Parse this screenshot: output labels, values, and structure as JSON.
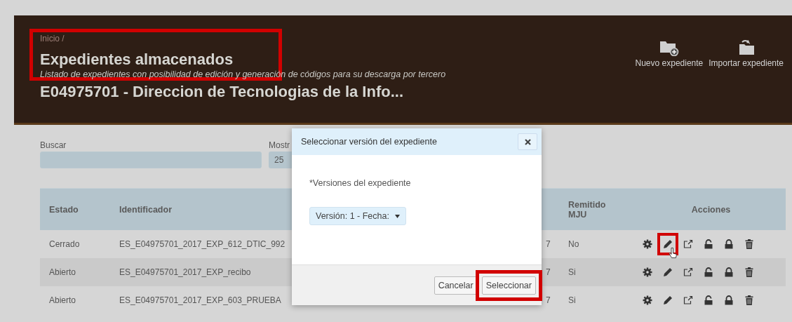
{
  "header": {
    "breadcrumb": "Inicio /",
    "title": {
      "text": "Expedientes almacenados",
      "highlighted": true
    },
    "subtitle": "Listado de expedientes con posibilidad de edición y generación de códigos para su descarga por tercero",
    "organization": "E04975701 - Direccion de Tecnologias de la Info...",
    "actions": [
      {
        "kind": "new-folder",
        "label": "Nuevo expediente"
      },
      {
        "kind": "import-folder",
        "label": "Importar expediente"
      }
    ]
  },
  "filters": {
    "search": {
      "label": "Buscar"
    },
    "page_size": {
      "label": "Mostr",
      "value": "25"
    }
  },
  "table": {
    "columns": [
      "Estado",
      "Identificador",
      "",
      "Remitido MJU",
      "Acciones"
    ],
    "rows": [
      {
        "estado": "Cerrado",
        "identificador": "ES_E04975701_2017_EXP_612_DTIC_992",
        "column_3": "7",
        "remitido": "No",
        "actions": [
          {
            "kind": "settings",
            "highlighted": false,
            "hovered": false
          },
          {
            "kind": "edit",
            "highlighted": true,
            "hovered": true
          },
          {
            "kind": "export",
            "highlighted": false,
            "hovered": false
          },
          {
            "kind": "unlock",
            "highlighted": false,
            "hovered": false
          },
          {
            "kind": "lock",
            "highlighted": false,
            "hovered": false
          },
          {
            "kind": "delete",
            "highlighted": false,
            "hovered": false
          }
        ]
      },
      {
        "estado": "Abierto",
        "identificador": "ES_E04975701_2017_EXP_recibo",
        "column_3": "7",
        "remitido": "Si",
        "actions": [
          {
            "kind": "settings",
            "highlighted": false,
            "hovered": false
          },
          {
            "kind": "edit",
            "highlighted": false,
            "hovered": false
          },
          {
            "kind": "export",
            "highlighted": false,
            "hovered": false
          },
          {
            "kind": "unlock",
            "highlighted": false,
            "hovered": false
          },
          {
            "kind": "lock",
            "highlighted": false,
            "hovered": false
          },
          {
            "kind": "delete",
            "highlighted": false,
            "hovered": false
          }
        ]
      },
      {
        "estado": "Abierto",
        "identificador": "ES_E04975701_2017_EXP_603_PRUEBA",
        "column_3": "7",
        "remitido": "Si",
        "actions": [
          {
            "kind": "settings",
            "highlighted": false,
            "hovered": false
          },
          {
            "kind": "edit",
            "highlighted": false,
            "hovered": false
          },
          {
            "kind": "export",
            "highlighted": false,
            "hovered": false
          },
          {
            "kind": "unlock",
            "highlighted": false,
            "hovered": false
          },
          {
            "kind": "lock",
            "highlighted": false,
            "hovered": false
          },
          {
            "kind": "delete",
            "highlighted": false,
            "hovered": false
          }
        ]
      }
    ]
  },
  "dialog": {
    "title": "Seleccionar versión del expediente",
    "field_label": "*Versiones del expediente",
    "select_value": "Versión: 1 - Fecha:",
    "buttons": [
      {
        "label": "Cancelar",
        "highlighted": false
      },
      {
        "label": "Seleccionar",
        "highlighted": true
      }
    ]
  }
}
